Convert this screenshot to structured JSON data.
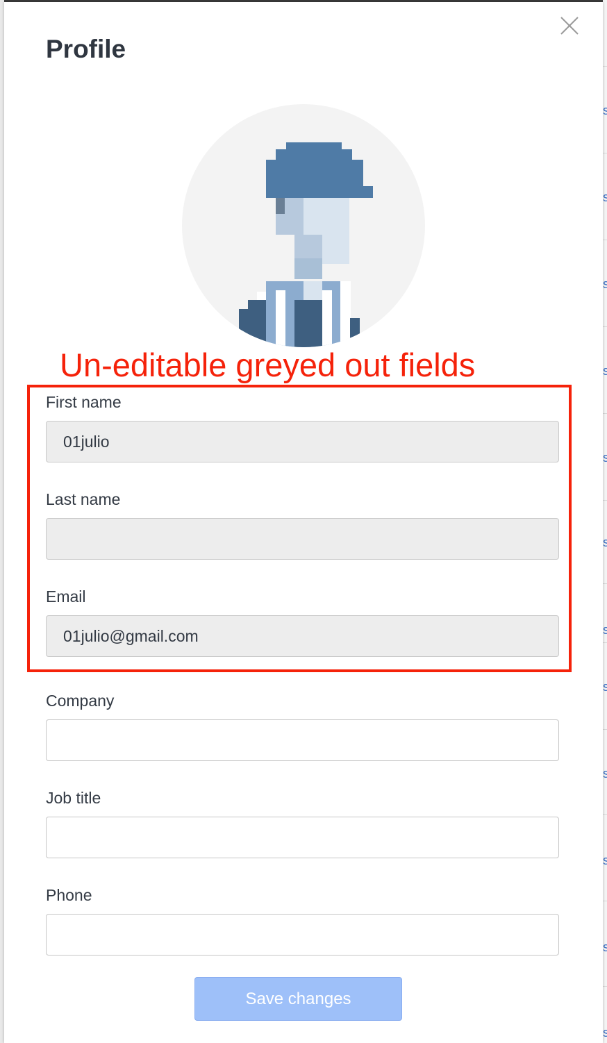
{
  "modal": {
    "title": "Profile",
    "close_icon": "close-icon"
  },
  "avatar": {
    "description_icon": "pixel-person-avatar"
  },
  "annotation": {
    "text": "Un-editable greyed out fields",
    "color": "#f5220a"
  },
  "form": {
    "first_name": {
      "label": "First name",
      "value": "01julio",
      "disabled": true
    },
    "last_name": {
      "label": "Last name",
      "value": "",
      "disabled": true
    },
    "email": {
      "label": "Email",
      "value": "01julio@gmail.com",
      "disabled": true
    },
    "company": {
      "label": "Company",
      "value": "",
      "disabled": false
    },
    "job_title": {
      "label": "Job title",
      "value": "",
      "disabled": false
    },
    "phone": {
      "label": "Phone",
      "value": "",
      "disabled": false
    }
  },
  "save_button": {
    "label": "Save changes",
    "color": "#9ec0f9"
  },
  "backdrop": {
    "partial_char": "s",
    "link_color": "#3b6fc4"
  }
}
